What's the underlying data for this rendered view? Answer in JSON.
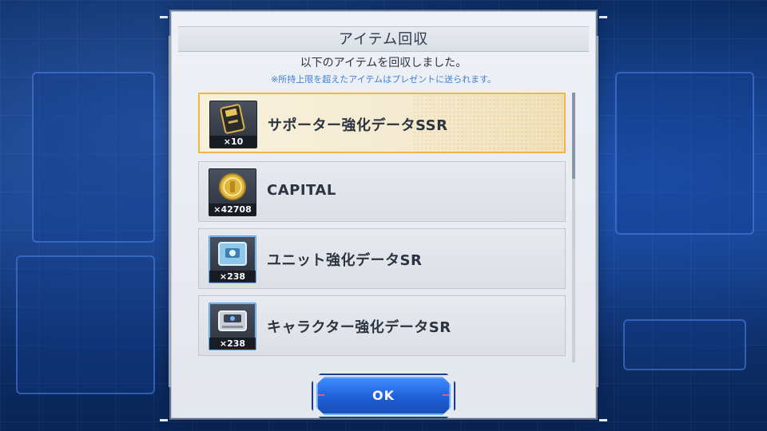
{
  "dialog": {
    "title": "アイテム回収",
    "message": "以下のアイテムを回収しました。",
    "note": "※所持上限を超えたアイテムはプレゼントに送られます。"
  },
  "items": [
    {
      "label": "サポーター強化データSSR",
      "quantity": "×10",
      "icon": "gold-chip-icon",
      "selected": true
    },
    {
      "label": "CAPITAL",
      "quantity": "×42708",
      "icon": "gold-coin-icon",
      "selected": false
    },
    {
      "label": "ユニット強化データSR",
      "quantity": "×238",
      "icon": "blue-data-card-icon",
      "selected": false
    },
    {
      "label": "キャラクター強化データSR",
      "quantity": "×238",
      "icon": "gray-data-device-icon",
      "selected": false
    }
  ],
  "ok_button": {
    "label": "OK"
  },
  "colors": {
    "selected_border": "#f0b64a",
    "note_text": "#3f7fd6",
    "button_blue": "#1d5fd6"
  }
}
